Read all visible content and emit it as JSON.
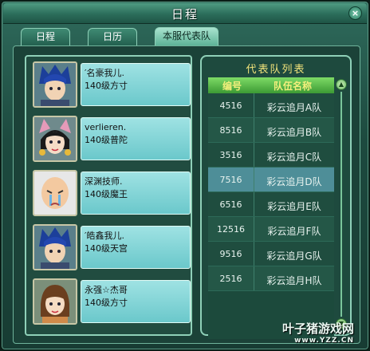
{
  "window": {
    "title": "日程",
    "close_glyph": "×"
  },
  "tabs": [
    {
      "label": "日程"
    },
    {
      "label": "日历"
    },
    {
      "label": "本服代表队",
      "active": true
    }
  ],
  "members": [
    {
      "name": "′名豪我儿.",
      "level": "140级方寸"
    },
    {
      "name": "verlieren.",
      "level": "140级普陀"
    },
    {
      "name": "深渊技师.",
      "level": "140级魔王"
    },
    {
      "name": "′皓鑫我儿.",
      "level": "140级天宫"
    },
    {
      "name": "永强☆杰哥",
      "level": "140级方寸"
    }
  ],
  "team_panel": {
    "title": "代表队列表",
    "col_number": "编号",
    "col_name": "队伍名称",
    "rows": [
      {
        "number": "4516",
        "name": "彩云追月A队"
      },
      {
        "number": "8516",
        "name": "彩云追月B队"
      },
      {
        "number": "3516",
        "name": "彩云追月C队"
      },
      {
        "number": "7516",
        "name": "彩云追月D队",
        "selected": true
      },
      {
        "number": "6516",
        "name": "彩云追月E队"
      },
      {
        "number": "12516",
        "name": "彩云追月F队"
      },
      {
        "number": "9516",
        "name": "彩云追月G队"
      },
      {
        "number": "2516",
        "name": "彩云追月H队"
      }
    ],
    "scroll_up_glyph": "▲",
    "scroll_down_glyph": "▼"
  },
  "watermark": {
    "text": "叶子猪游戏网",
    "url": "www.YZZ.CN"
  },
  "colors": {
    "accent_green": "#3c9a34",
    "header_text": "#f3ef7c",
    "selected_row": "#4e8e98"
  }
}
